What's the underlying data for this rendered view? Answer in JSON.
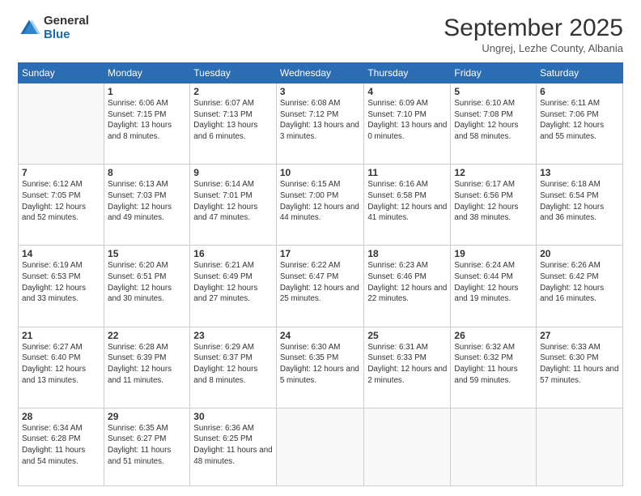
{
  "header": {
    "logo_general": "General",
    "logo_blue": "Blue",
    "title": "September 2025",
    "location": "Ungrej, Lezhe County, Albania"
  },
  "days_of_week": [
    "Sunday",
    "Monday",
    "Tuesday",
    "Wednesday",
    "Thursday",
    "Friday",
    "Saturday"
  ],
  "weeks": [
    [
      {
        "day": null
      },
      {
        "day": "1",
        "sunrise": "6:06 AM",
        "sunset": "7:15 PM",
        "daylight": "13 hours and 8 minutes."
      },
      {
        "day": "2",
        "sunrise": "6:07 AM",
        "sunset": "7:13 PM",
        "daylight": "13 hours and 6 minutes."
      },
      {
        "day": "3",
        "sunrise": "6:08 AM",
        "sunset": "7:12 PM",
        "daylight": "13 hours and 3 minutes."
      },
      {
        "day": "4",
        "sunrise": "6:09 AM",
        "sunset": "7:10 PM",
        "daylight": "13 hours and 0 minutes."
      },
      {
        "day": "5",
        "sunrise": "6:10 AM",
        "sunset": "7:08 PM",
        "daylight": "12 hours and 58 minutes."
      },
      {
        "day": "6",
        "sunrise": "6:11 AM",
        "sunset": "7:06 PM",
        "daylight": "12 hours and 55 minutes."
      }
    ],
    [
      {
        "day": "7",
        "sunrise": "6:12 AM",
        "sunset": "7:05 PM",
        "daylight": "12 hours and 52 minutes."
      },
      {
        "day": "8",
        "sunrise": "6:13 AM",
        "sunset": "7:03 PM",
        "daylight": "12 hours and 49 minutes."
      },
      {
        "day": "9",
        "sunrise": "6:14 AM",
        "sunset": "7:01 PM",
        "daylight": "12 hours and 47 minutes."
      },
      {
        "day": "10",
        "sunrise": "6:15 AM",
        "sunset": "7:00 PM",
        "daylight": "12 hours and 44 minutes."
      },
      {
        "day": "11",
        "sunrise": "6:16 AM",
        "sunset": "6:58 PM",
        "daylight": "12 hours and 41 minutes."
      },
      {
        "day": "12",
        "sunrise": "6:17 AM",
        "sunset": "6:56 PM",
        "daylight": "12 hours and 38 minutes."
      },
      {
        "day": "13",
        "sunrise": "6:18 AM",
        "sunset": "6:54 PM",
        "daylight": "12 hours and 36 minutes."
      }
    ],
    [
      {
        "day": "14",
        "sunrise": "6:19 AM",
        "sunset": "6:53 PM",
        "daylight": "12 hours and 33 minutes."
      },
      {
        "day": "15",
        "sunrise": "6:20 AM",
        "sunset": "6:51 PM",
        "daylight": "12 hours and 30 minutes."
      },
      {
        "day": "16",
        "sunrise": "6:21 AM",
        "sunset": "6:49 PM",
        "daylight": "12 hours and 27 minutes."
      },
      {
        "day": "17",
        "sunrise": "6:22 AM",
        "sunset": "6:47 PM",
        "daylight": "12 hours and 25 minutes."
      },
      {
        "day": "18",
        "sunrise": "6:23 AM",
        "sunset": "6:46 PM",
        "daylight": "12 hours and 22 minutes."
      },
      {
        "day": "19",
        "sunrise": "6:24 AM",
        "sunset": "6:44 PM",
        "daylight": "12 hours and 19 minutes."
      },
      {
        "day": "20",
        "sunrise": "6:26 AM",
        "sunset": "6:42 PM",
        "daylight": "12 hours and 16 minutes."
      }
    ],
    [
      {
        "day": "21",
        "sunrise": "6:27 AM",
        "sunset": "6:40 PM",
        "daylight": "12 hours and 13 minutes."
      },
      {
        "day": "22",
        "sunrise": "6:28 AM",
        "sunset": "6:39 PM",
        "daylight": "12 hours and 11 minutes."
      },
      {
        "day": "23",
        "sunrise": "6:29 AM",
        "sunset": "6:37 PM",
        "daylight": "12 hours and 8 minutes."
      },
      {
        "day": "24",
        "sunrise": "6:30 AM",
        "sunset": "6:35 PM",
        "daylight": "12 hours and 5 minutes."
      },
      {
        "day": "25",
        "sunrise": "6:31 AM",
        "sunset": "6:33 PM",
        "daylight": "12 hours and 2 minutes."
      },
      {
        "day": "26",
        "sunrise": "6:32 AM",
        "sunset": "6:32 PM",
        "daylight": "11 hours and 59 minutes."
      },
      {
        "day": "27",
        "sunrise": "6:33 AM",
        "sunset": "6:30 PM",
        "daylight": "11 hours and 57 minutes."
      }
    ],
    [
      {
        "day": "28",
        "sunrise": "6:34 AM",
        "sunset": "6:28 PM",
        "daylight": "11 hours and 54 minutes."
      },
      {
        "day": "29",
        "sunrise": "6:35 AM",
        "sunset": "6:27 PM",
        "daylight": "11 hours and 51 minutes."
      },
      {
        "day": "30",
        "sunrise": "6:36 AM",
        "sunset": "6:25 PM",
        "daylight": "11 hours and 48 minutes."
      },
      {
        "day": null
      },
      {
        "day": null
      },
      {
        "day": null
      },
      {
        "day": null
      }
    ]
  ]
}
